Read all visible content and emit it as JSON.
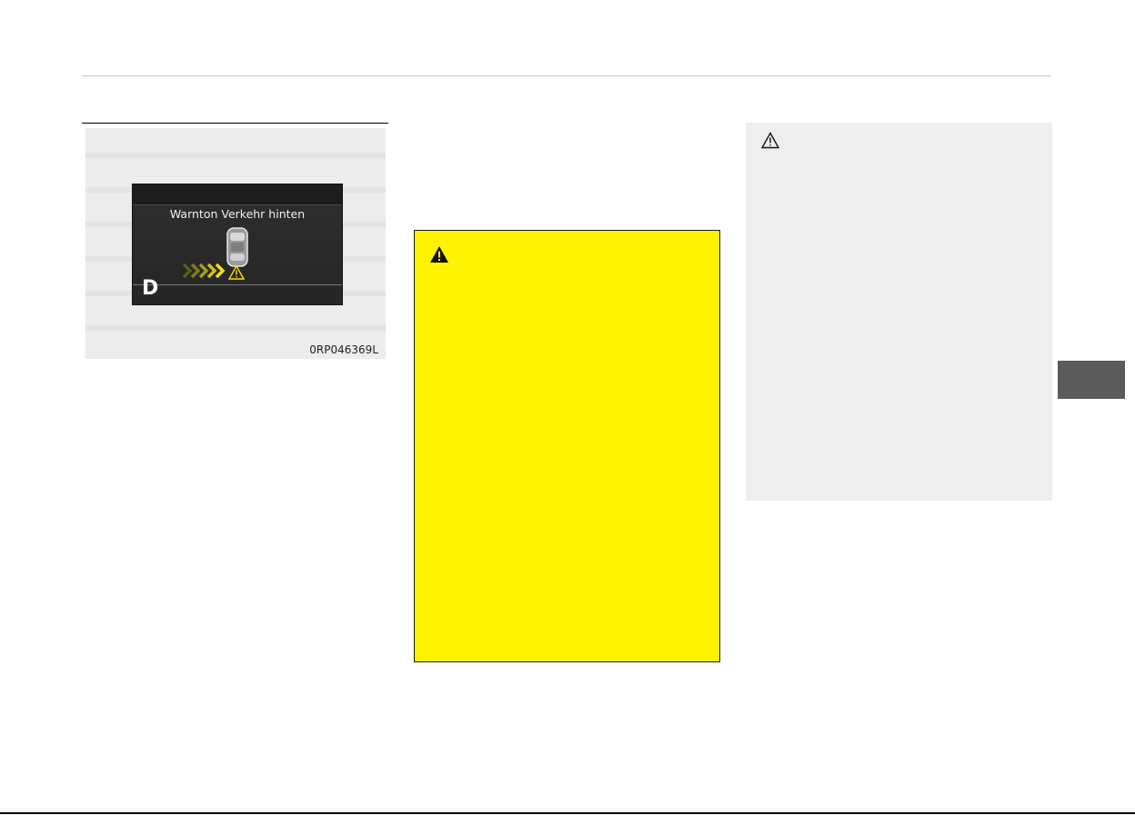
{
  "figure": {
    "caption": "0RP046369L",
    "display": {
      "message": "Warnton Verkehr hinten",
      "gear": "D",
      "icons": [
        "car-top-view-icon",
        "approach-arrows-icon",
        "warning-triangle-icon"
      ]
    }
  },
  "warning_box": {
    "icon": "warning-triangle-filled-icon",
    "color": "#fff200"
  },
  "caution_box": {
    "icon": "warning-triangle-outline-icon",
    "color": "#eeeeee"
  },
  "colors": {
    "side_tab": "#5b5b5b",
    "display_bg": "#2b2b2b",
    "arrow_yellow": "#f4e300"
  }
}
